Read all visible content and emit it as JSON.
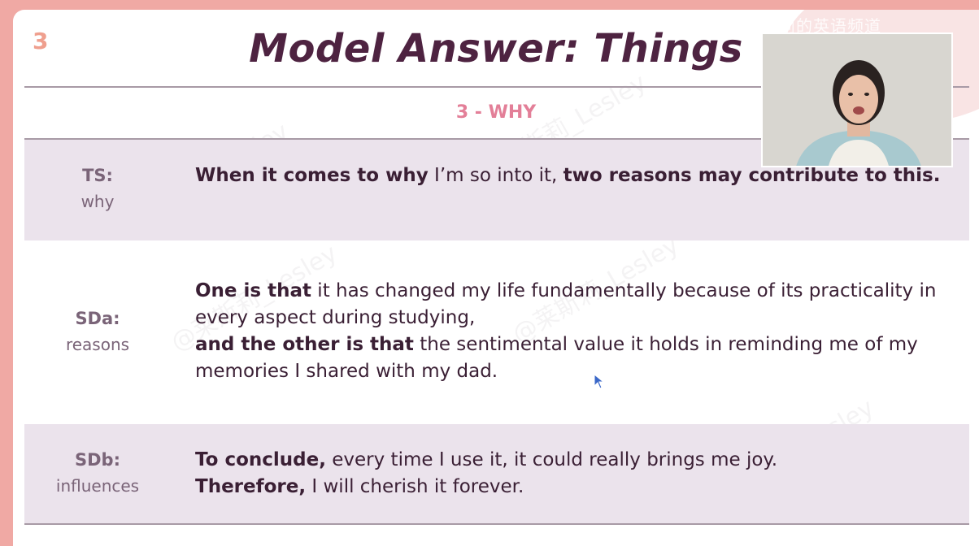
{
  "slide": {
    "number": "3",
    "title": "Model Answer: Things",
    "subheading": "3 - WHY"
  },
  "rows": [
    {
      "label_main": "TS:",
      "label_sub": "why",
      "parts": [
        {
          "bold": "When it comes to why",
          "normal": " I’m so into it, "
        },
        {
          "bold": "two reasons may contribute to this.",
          "normal": ""
        }
      ]
    },
    {
      "label_main": "SDa:",
      "label_sub": "reasons",
      "parts": [
        {
          "bold": "One is that",
          "normal": " it has changed my life fundamentally because of its practicality in every aspect during studying,"
        },
        {
          "bold": "and the other is that",
          "normal": " the sentimental value it holds in reminding me of my memories I shared with my dad."
        }
      ]
    },
    {
      "label_main": "SDb:",
      "label_sub": "influences",
      "parts": [
        {
          "bold": "To conclude,",
          "normal": " every time I use it, it could really brings me joy."
        },
        {
          "bold": "Therefore,",
          "normal": " I will cherish it forever."
        }
      ]
    }
  ],
  "overlay": {
    "brand": "莱斯莉的英语频道",
    "watermark": "@莱斯莉_Lesley"
  },
  "colors": {
    "title": "#4e2341",
    "subheading": "#e37f98",
    "shaded_row": "#ebe3ec",
    "frame": "#f0a9a4"
  }
}
